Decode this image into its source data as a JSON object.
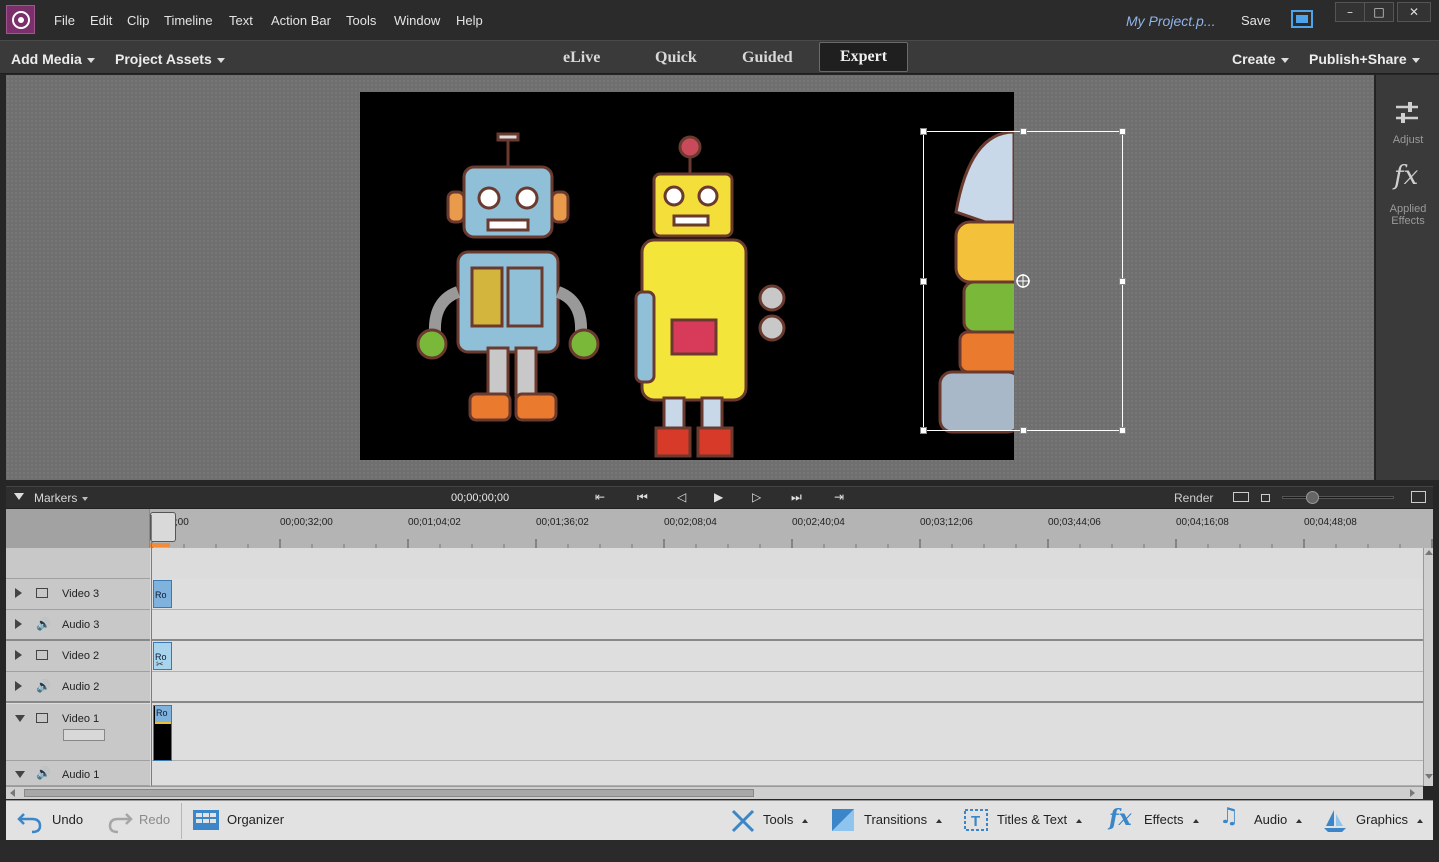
{
  "menu": [
    "File",
    "Edit",
    "Clip",
    "Timeline",
    "Text",
    "Action Bar",
    "Tools",
    "Window",
    "Help"
  ],
  "project_name": "My Project.p...",
  "save_label": "Save",
  "window_controls": {
    "minimize": "–",
    "maximize": "□",
    "close": "✕"
  },
  "modebar": {
    "add_media": "Add Media",
    "project_assets": "Project Assets",
    "tabs": [
      "eLive",
      "Quick",
      "Guided",
      "Expert"
    ],
    "active_tab": "Expert",
    "create": "Create",
    "publish": "Publish+Share"
  },
  "right_panel": {
    "adjust": "Adjust",
    "applied_effects_1": "Applied",
    "applied_effects_2": "Effects"
  },
  "timeline_controls": {
    "markers": "Markers",
    "timecode": "00;00;00;00",
    "render": "Render"
  },
  "ruler": {
    "ticks": [
      "00;00;00;00",
      "00;00;32;00",
      "00;01;04;02",
      "00;01;36;02",
      "00;02;08;04",
      "00;02;40;04",
      "00;03;12;06",
      "00;03;44;06",
      "00;04;16;08",
      "00;04;48;08"
    ],
    "first_tick_display": ";00;00"
  },
  "tracks": [
    {
      "name": "Video 3",
      "kind": "video",
      "expanded": false,
      "clip": "Ro"
    },
    {
      "name": "Audio 3",
      "kind": "audio",
      "expanded": false,
      "clip": ""
    },
    {
      "name": "Video 2",
      "kind": "video",
      "expanded": false,
      "clip": "Ro"
    },
    {
      "name": "Audio 2",
      "kind": "audio",
      "expanded": false,
      "clip": ""
    },
    {
      "name": "Video 1",
      "kind": "video",
      "expanded": true,
      "clip": "Ro"
    },
    {
      "name": "Audio 1",
      "kind": "audio",
      "expanded": true,
      "clip": ""
    }
  ],
  "actionbar": {
    "undo": "Undo",
    "redo": "Redo",
    "organizer": "Organizer",
    "tools": "Tools",
    "transitions": "Transitions",
    "titles": "Titles & Text",
    "effects": "Effects",
    "audio": "Audio",
    "graphics": "Graphics"
  },
  "colors": {
    "accent_blue": "#4fa3e8",
    "playhead": "#e25a2a",
    "clip": "#7fb2dd",
    "logo": "#7b2f6b"
  },
  "icons": [
    "app-logo-icon",
    "fullscreen-icon",
    "adjust-icon",
    "fx-icon",
    "undo-icon",
    "redo-icon",
    "organizer-icon",
    "tools-icon",
    "transitions-icon",
    "titles-icon",
    "effects-icon",
    "audio-icon",
    "graphics-icon"
  ]
}
